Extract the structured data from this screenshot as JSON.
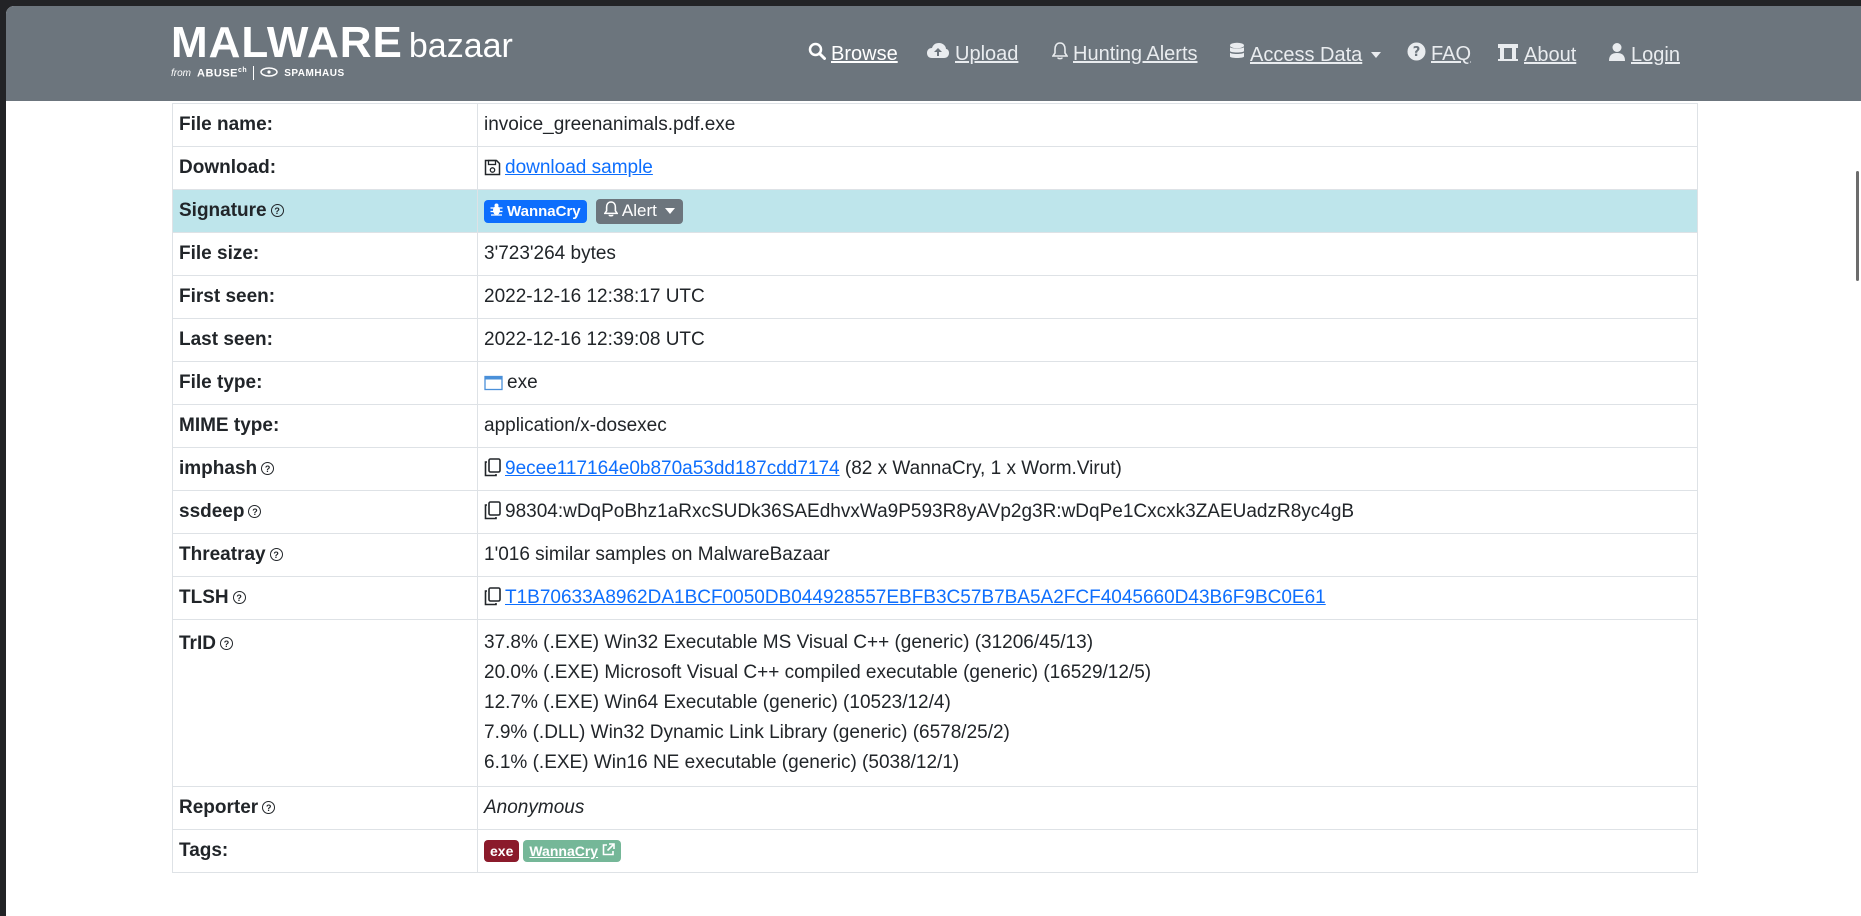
{
  "brand": {
    "main": "MALWARE",
    "secondary": "bazaar",
    "from": "from",
    "abuse": "ABUSE",
    "abuse_sup": "ch",
    "spamhaus": "SPAMHAUS"
  },
  "nav": {
    "browse": "Browse",
    "upload": "Upload",
    "hunting_alerts": "Hunting Alerts",
    "access_data": "Access Data",
    "faq": "FAQ",
    "about": "About",
    "login": "Login"
  },
  "details": {
    "file_name": {
      "label": "File name:",
      "value": "invoice_greenanimals.pdf.exe"
    },
    "download": {
      "label": "Download:",
      "value": "download sample"
    },
    "signature": {
      "label": "Signature",
      "badge": "WannaCry",
      "alert": "Alert"
    },
    "file_size": {
      "label": "File size:",
      "value": "3'723'264 bytes"
    },
    "first_seen": {
      "label": "First seen:",
      "value": "2022-12-16 12:38:17 UTC"
    },
    "last_seen": {
      "label": "Last seen:",
      "value": "2022-12-16 12:39:08 UTC"
    },
    "file_type": {
      "label": "File type:",
      "value": "exe"
    },
    "mime_type": {
      "label": "MIME type:",
      "value": "application/x-dosexec"
    },
    "imphash": {
      "label": "imphash",
      "value": "9ecee117164e0b870a53dd187cdd7174",
      "extra": "(82 x WannaCry, 1 x Worm.Virut)"
    },
    "ssdeep": {
      "label": "ssdeep",
      "value": "98304:wDqPoBhz1aRxcSUDk36SAEdhvxWa9P593R8yAVp2g3R:wDqPe1Cxcxk3ZAEUadzR8yc4gB"
    },
    "threatray": {
      "label": "Threatray",
      "value": "1'016 similar samples on MalwareBazaar"
    },
    "tlsh": {
      "label": "TLSH",
      "value": "T1B70633A8962DA1BCF0050DB044928557EBFB3C57B7BA5A2FCF4045660D43B6F9BC0E61"
    },
    "trid": {
      "label": "TrID",
      "lines": [
        "37.8% (.EXE) Win32 Executable MS Visual C++ (generic) (31206/45/13)",
        "20.0% (.EXE) Microsoft Visual C++ compiled executable (generic) (16529/12/5)",
        "12.7% (.EXE) Win64 Executable (generic) (10523/12/4)",
        "7.9% (.DLL) Win32 Dynamic Link Library (generic) (6578/25/2)",
        "6.1% (.EXE) Win16 NE executable (generic) (5038/12/1)"
      ]
    },
    "reporter": {
      "label": "Reporter",
      "value": "Anonymous"
    },
    "tags": {
      "label": "Tags:",
      "tag1": "exe",
      "tag2": "WannaCry"
    }
  },
  "help_mark": "?",
  "colors": {
    "navbar": "#6c757d",
    "highlight_row": "#bee5eb",
    "link": "#0d6efd",
    "tag_exe": "#8b1a2b",
    "tag_wannacry": "#75b798"
  }
}
